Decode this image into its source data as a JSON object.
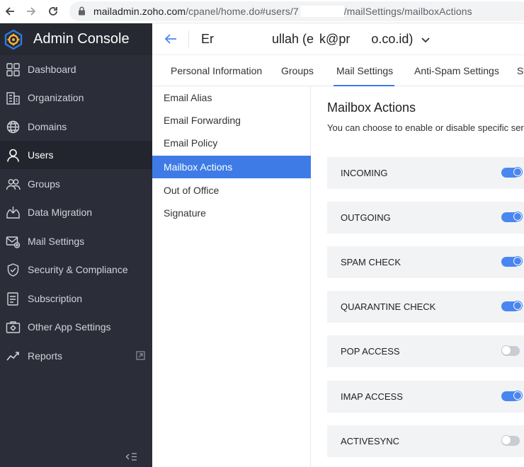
{
  "browser": {
    "url_domain": "mailadmin.zoho.com",
    "url_path_a": "/cpanel/home.do#users/7",
    "url_path_b": "/mailSettings/mailboxActions"
  },
  "brand": {
    "title": "Admin Console",
    "icon": "gear-logo-icon"
  },
  "sidebar": {
    "items": [
      {
        "label": "Dashboard",
        "icon": "dashboard-icon"
      },
      {
        "label": "Organization",
        "icon": "organization-icon"
      },
      {
        "label": "Domains",
        "icon": "globe-icon"
      },
      {
        "label": "Users",
        "icon": "user-icon",
        "active": true
      },
      {
        "label": "Groups",
        "icon": "groups-icon"
      },
      {
        "label": "Data Migration",
        "icon": "migration-icon"
      },
      {
        "label": "Mail Settings",
        "icon": "mail-settings-icon"
      },
      {
        "label": "Security & Compliance",
        "icon": "shield-icon"
      },
      {
        "label": "Subscription",
        "icon": "subscription-icon"
      },
      {
        "label": "Other App Settings",
        "icon": "app-settings-icon"
      },
      {
        "label": "Reports",
        "icon": "reports-icon"
      }
    ]
  },
  "user_header": {
    "name_part_a": "Er",
    "name_part_b": "ullah (e",
    "name_part_c": "k@pr",
    "name_part_d": "o.co.id)"
  },
  "tabs": [
    {
      "label": "Personal Information"
    },
    {
      "label": "Groups"
    },
    {
      "label": "Mail Settings",
      "active": true
    },
    {
      "label": "Anti-Spam Settings"
    },
    {
      "label": "St"
    }
  ],
  "sub_nav": [
    {
      "label": "Email Alias"
    },
    {
      "label": "Email Forwarding"
    },
    {
      "label": "Email Policy"
    },
    {
      "label": "Mailbox Actions",
      "active": true
    },
    {
      "label": "Out of Office"
    },
    {
      "label": "Signature"
    }
  ],
  "content": {
    "title": "Mailbox Actions",
    "description": "You can choose to enable or disable specific servic"
  },
  "actions": [
    {
      "label": "INCOMING",
      "enabled": true
    },
    {
      "label": "OUTGOING",
      "enabled": true
    },
    {
      "label": "SPAM CHECK",
      "enabled": true
    },
    {
      "label": "QUARANTINE CHECK",
      "enabled": true
    },
    {
      "label": "POP ACCESS",
      "enabled": false
    },
    {
      "label": "IMAP ACCESS",
      "enabled": true
    },
    {
      "label": "ACTIVESYNC",
      "enabled": false
    }
  ],
  "colors": {
    "accent": "#3e7be6",
    "sidebar_bg": "#2b2e38",
    "toggle_on": "#4a86f0"
  }
}
